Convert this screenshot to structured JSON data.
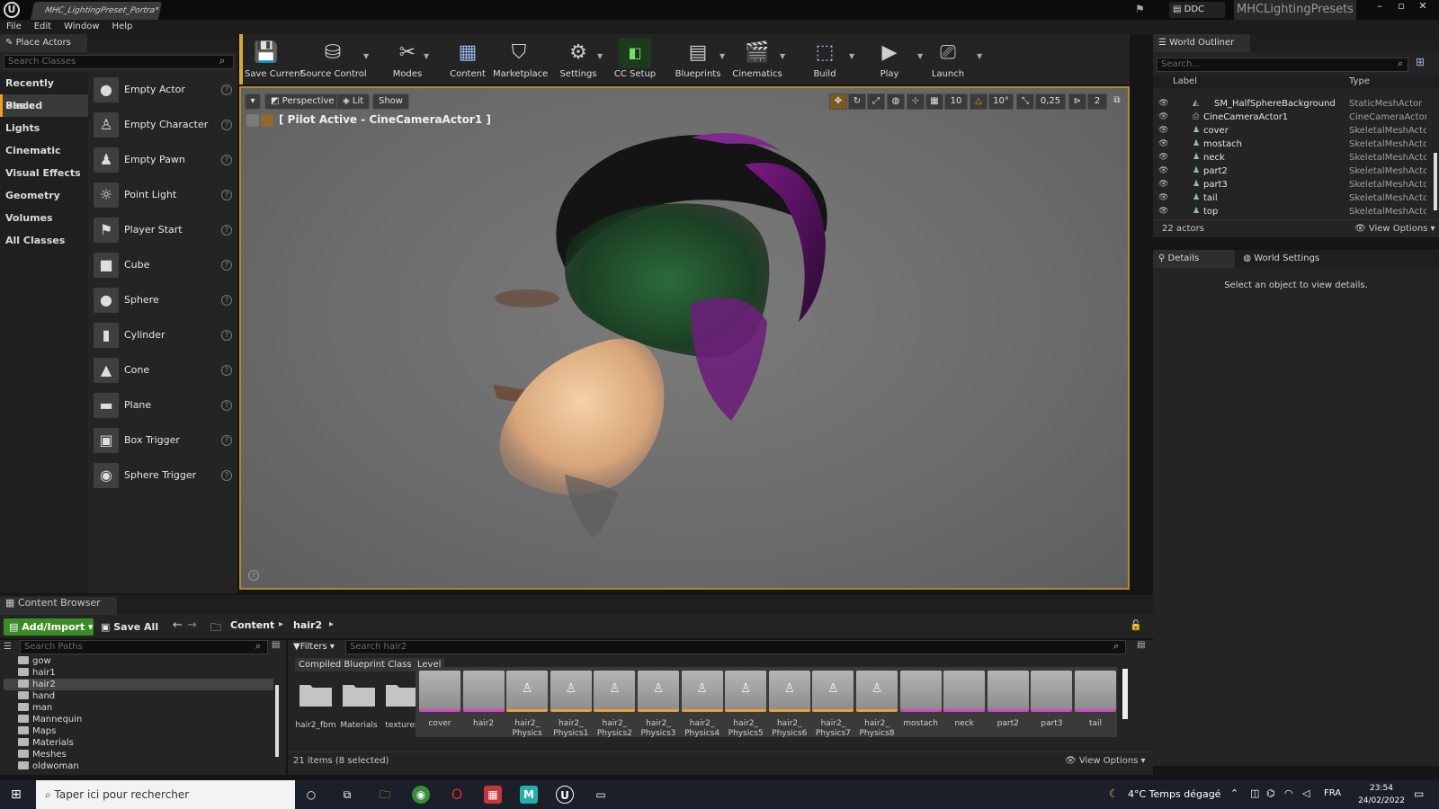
{
  "window": {
    "tab_title": "MHC_LightingPreset_Portra*",
    "ddc_label": "DDC",
    "project_name": "MHCLightingPresets"
  },
  "menu": [
    "File",
    "Edit",
    "Window",
    "Help"
  ],
  "place_actors": {
    "title": "Place Actors",
    "search_placeholder": "Search Classes",
    "categories": [
      "Recently Placed",
      "Basic",
      "Lights",
      "Cinematic",
      "Visual Effects",
      "Geometry",
      "Volumes",
      "All Classes"
    ],
    "selected_category": "Basic",
    "items": [
      "Empty Actor",
      "Empty Character",
      "Empty Pawn",
      "Point Light",
      "Player Start",
      "Cube",
      "Sphere",
      "Cylinder",
      "Cone",
      "Plane",
      "Box Trigger",
      "Sphere Trigger"
    ]
  },
  "toolbar": {
    "buttons": [
      "Save Current",
      "Source Control",
      "Modes",
      "Content",
      "Marketplace",
      "Settings",
      "CC Setup",
      "Blueprints",
      "Cinematics",
      "Build",
      "Play",
      "Launch"
    ]
  },
  "viewport": {
    "perspective_label": "Perspective",
    "lit_label": "Lit",
    "show_label": "Show",
    "pilot_label": "[ Pilot Active - CineCameraActor1 ]",
    "grid_snap": "10",
    "rotation_snap": "10°",
    "scale_snap": "0,25",
    "camera_speed": "2"
  },
  "world_outliner": {
    "title": "World Outliner",
    "search_placeholder": "Search...",
    "col_label": "Label",
    "col_type": "Type",
    "rows": [
      {
        "name": "SM_HalfSphereBackground",
        "type": "StaticMeshActor"
      },
      {
        "name": "CineCameraActor1",
        "type": "CineCameraActor"
      },
      {
        "name": "cover",
        "type": "SkeletalMeshActo"
      },
      {
        "name": "mostach",
        "type": "SkeletalMeshActo"
      },
      {
        "name": "neck",
        "type": "SkeletalMeshActo"
      },
      {
        "name": "part2",
        "type": "SkeletalMeshActo"
      },
      {
        "name": "part3",
        "type": "SkeletalMeshActo"
      },
      {
        "name": "tail",
        "type": "SkeletalMeshActo"
      },
      {
        "name": "top",
        "type": "SkeletalMeshActo"
      }
    ],
    "actor_count": "22 actors",
    "view_options": "View Options"
  },
  "details": {
    "tab_details": "Details",
    "tab_world_settings": "World Settings",
    "empty_message": "Select an object to view details."
  },
  "content_browser": {
    "title": "Content Browser",
    "add_import": "Add/Import",
    "save_all": "Save All",
    "path_root": "Content",
    "path_folder": "hair2",
    "search_paths_placeholder": "Search Paths",
    "filters_label": "Filters",
    "search_assets_placeholder": "Search hair2",
    "filter_chips": [
      "Compiled Blueprint Class",
      "Level"
    ],
    "tree": [
      "gow",
      "hair1",
      "hair2",
      "hand",
      "man",
      "Mannequin",
      "Maps",
      "Materials",
      "Meshes",
      "oldwoman"
    ],
    "selected_tree": "hair2",
    "folders": [
      "hair2_fbm",
      "Materials",
      "textures"
    ],
    "assets": [
      {
        "label": "cover",
        "kind": "mesh"
      },
      {
        "label": "hair2",
        "kind": "mesh"
      },
      {
        "label": "hair2_ Physics",
        "kind": "physics"
      },
      {
        "label": "hair2_ Physics1",
        "kind": "physics"
      },
      {
        "label": "hair2_ Physics2",
        "kind": "physics"
      },
      {
        "label": "hair2_ Physics3",
        "kind": "physics"
      },
      {
        "label": "hair2_ Physics4",
        "kind": "physics"
      },
      {
        "label": "hair2_ Physics5",
        "kind": "physics"
      },
      {
        "label": "hair2_ Physics6",
        "kind": "physics"
      },
      {
        "label": "hair2_ Physics7",
        "kind": "physics"
      },
      {
        "label": "hair2_ Physics8",
        "kind": "physics"
      },
      {
        "label": "mostach",
        "kind": "mesh"
      },
      {
        "label": "neck",
        "kind": "mesh"
      },
      {
        "label": "part2",
        "kind": "mesh"
      },
      {
        "label": "part3",
        "kind": "mesh"
      },
      {
        "label": "tail",
        "kind": "mesh"
      }
    ],
    "status": "21 items (8 selected)",
    "view_options": "View Options"
  },
  "taskbar": {
    "search_placeholder": "Taper ici pour rechercher",
    "weather": "4°C  Temps dégagé",
    "language": "FRA",
    "time": "23:54",
    "date": "24/02/2022"
  },
  "colors": {
    "accent_orange": "#f0a020",
    "add_import_green": "#3d8b26",
    "mesh_tab": "#d147c4",
    "physics_tab": "#e8a13a",
    "viewport_border": "#b18b2a"
  }
}
